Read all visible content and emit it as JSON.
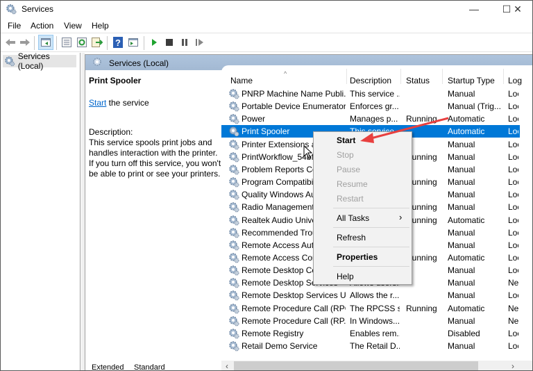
{
  "window": {
    "title": "Services",
    "controls": {
      "minimize": "—",
      "maximize": "☐",
      "close": "✕"
    }
  },
  "menubar": [
    "File",
    "Action",
    "View",
    "Help"
  ],
  "toolbar": {
    "icons": [
      "back-arrow-icon",
      "forward-arrow-icon",
      "show-hide-console-tree-icon",
      "properties-icon",
      "refresh-icon",
      "export-list-icon",
      "help-icon",
      "show-action-pane-icon",
      "start-service-icon",
      "stop-service-icon",
      "pause-service-icon",
      "restart-service-icon"
    ]
  },
  "tree": {
    "root_label": "Services (Local)"
  },
  "pane": {
    "header": "Services (Local)",
    "detail": {
      "service_name": "Print Spooler",
      "start_link": "Start",
      "start_suffix": " the service",
      "description_label": "Description:",
      "description": "This service spools print jobs and handles interaction with the printer. If you turn off this service, you won't be able to print or see your printers."
    }
  },
  "list": {
    "columns": [
      "Name",
      "Description",
      "Status",
      "Startup Type",
      "Log"
    ],
    "sort_indicator": "^",
    "rows": [
      {
        "name": "PNRP Machine Name Publi...",
        "description": "This service ...",
        "status": "",
        "startup": "Manual",
        "logon": "Loca"
      },
      {
        "name": "Portable Device Enumerator...",
        "description": "Enforces gr...",
        "status": "",
        "startup": "Manual (Trig...",
        "logon": "Loca"
      },
      {
        "name": "Power",
        "description": "Manages p...",
        "status": "Running",
        "startup": "Automatic",
        "logon": "Loca"
      },
      {
        "name": "Print Spooler",
        "description": "This service...",
        "status": "",
        "startup": "Automatic",
        "logon": "Loca",
        "selected": true
      },
      {
        "name": "Printer Extensions and...",
        "description": "",
        "status": "",
        "startup": "Manual",
        "logon": "Loca"
      },
      {
        "name": "PrintWorkflow_54bf...",
        "description": "",
        "status": "Running",
        "startup": "Manual",
        "logon": "Loca"
      },
      {
        "name": "Problem Reports Cor...",
        "description": "",
        "status": "",
        "startup": "Manual",
        "logon": "Loca"
      },
      {
        "name": "Program Compatibil...",
        "description": "",
        "status": "Running",
        "startup": "Manual",
        "logon": "Loca"
      },
      {
        "name": "Quality Windows Au...",
        "description": "",
        "status": "",
        "startup": "Manual",
        "logon": "Loca"
      },
      {
        "name": "Radio Management S...",
        "description": "",
        "status": "Running",
        "startup": "Manual",
        "logon": "Loca"
      },
      {
        "name": "Realtek Audio Univer...",
        "description": "",
        "status": "Running",
        "startup": "Automatic",
        "logon": "Loca"
      },
      {
        "name": "Recommended Troubl...",
        "description": "",
        "status": "",
        "startup": "Manual",
        "logon": "Loca"
      },
      {
        "name": "Remote Access Auto...",
        "description": "",
        "status": "",
        "startup": "Manual",
        "logon": "Loca"
      },
      {
        "name": "Remote Access Conn...",
        "description": "",
        "status": "Running",
        "startup": "Automatic",
        "logon": "Loca"
      },
      {
        "name": "Remote Desktop Con...",
        "description": "",
        "status": "",
        "startup": "Manual",
        "logon": "Loca"
      },
      {
        "name": "Remote Desktop Services",
        "description": "Allows users...",
        "status": "",
        "startup": "Manual",
        "logon": "Netw"
      },
      {
        "name": "Remote Desktop Services U...",
        "description": "Allows the r...",
        "status": "",
        "startup": "Manual",
        "logon": "Loca"
      },
      {
        "name": "Remote Procedure Call (RPC)",
        "description": "The RPCSS s...",
        "status": "Running",
        "startup": "Automatic",
        "logon": "Netw"
      },
      {
        "name": "Remote Procedure Call (RP...",
        "description": "In Windows...",
        "status": "",
        "startup": "Manual",
        "logon": "Netw"
      },
      {
        "name": "Remote Registry",
        "description": "Enables rem...",
        "status": "",
        "startup": "Disabled",
        "logon": "Loca"
      },
      {
        "name": "Retail Demo Service",
        "description": "The Retail D...",
        "status": "",
        "startup": "Manual",
        "logon": "Loca"
      }
    ]
  },
  "context_menu": {
    "items": [
      {
        "label": "Start",
        "state": "bold-enabled"
      },
      {
        "label": "Stop",
        "state": "disabled"
      },
      {
        "label": "Pause",
        "state": "disabled"
      },
      {
        "label": "Resume",
        "state": "disabled"
      },
      {
        "label": "Restart",
        "state": "disabled"
      },
      {
        "label": "All Tasks",
        "state": "enabled",
        "submenu": "›"
      },
      {
        "label": "Refresh",
        "state": "enabled"
      },
      {
        "label": "Properties",
        "state": "bold"
      },
      {
        "label": "Help",
        "state": "enabled"
      }
    ]
  },
  "tabs": [
    "Extended",
    "Standard"
  ],
  "annotation": {
    "arrow_color": "#e8403f"
  },
  "colors": {
    "selection": "#0078d7",
    "header": "#a9bfd8",
    "link": "#0066cc"
  }
}
